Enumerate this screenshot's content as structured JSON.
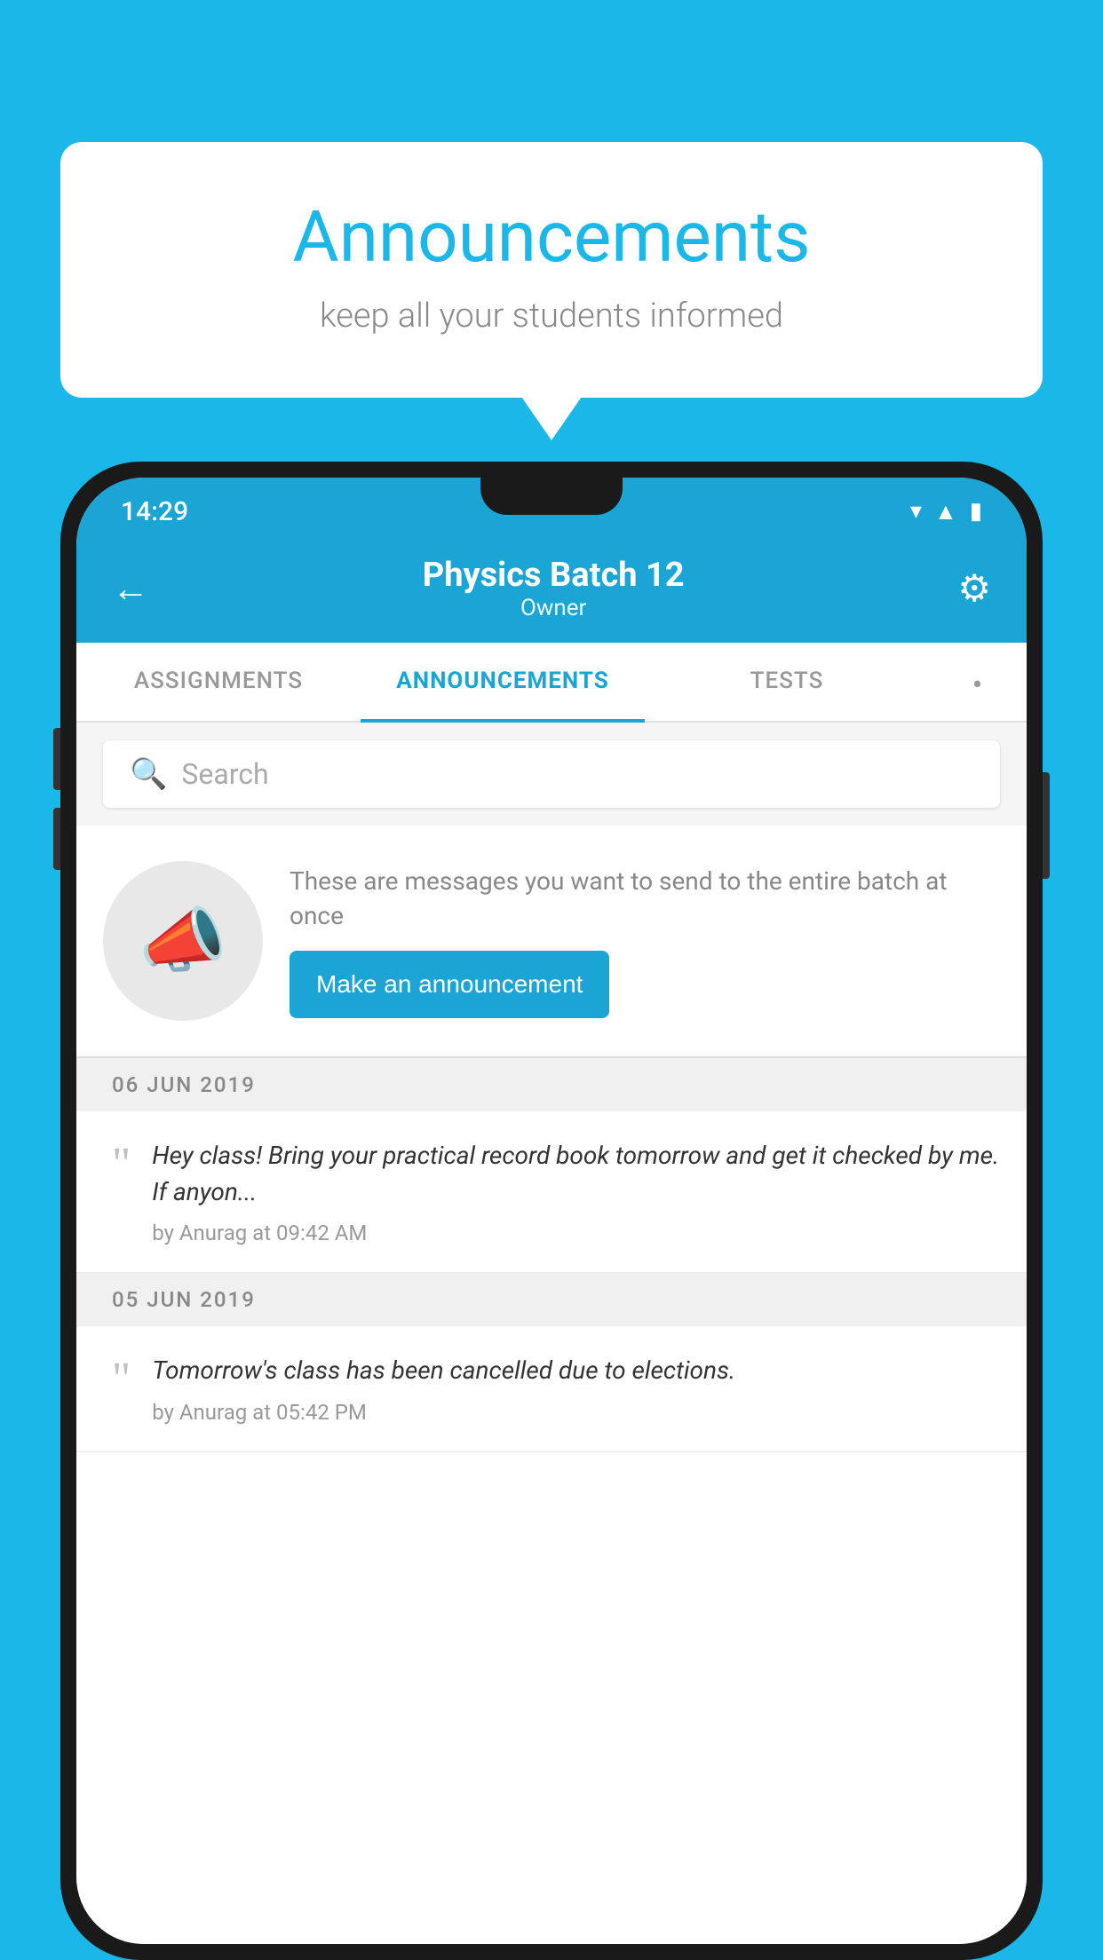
{
  "bubble": {
    "title": "Announcements",
    "subtitle": "keep all your students informed"
  },
  "phone": {
    "statusBar": {
      "time": "14:29"
    },
    "header": {
      "title": "Physics Batch 12",
      "subtitle": "Owner",
      "backLabel": "←",
      "gearLabel": "⚙"
    },
    "tabs": [
      {
        "label": "ASSIGNMENTS",
        "active": false
      },
      {
        "label": "ANNOUNCEMENTS",
        "active": true
      },
      {
        "label": "TESTS",
        "active": false
      },
      {
        "label": "•",
        "active": false
      }
    ],
    "search": {
      "placeholder": "Search"
    },
    "promo": {
      "text": "These are messages you want to send to the entire batch at once",
      "buttonLabel": "Make an announcement"
    },
    "announcements": [
      {
        "date": "06  JUN  2019",
        "text": "Hey class! Bring your practical record book tomorrow and get it checked by me. If anyon...",
        "meta": "by Anurag at 09:42 AM"
      },
      {
        "date": "05  JUN  2019",
        "text": "Tomorrow's class has been cancelled due to elections.",
        "meta": "by Anurag at 05:42 PM"
      }
    ]
  }
}
